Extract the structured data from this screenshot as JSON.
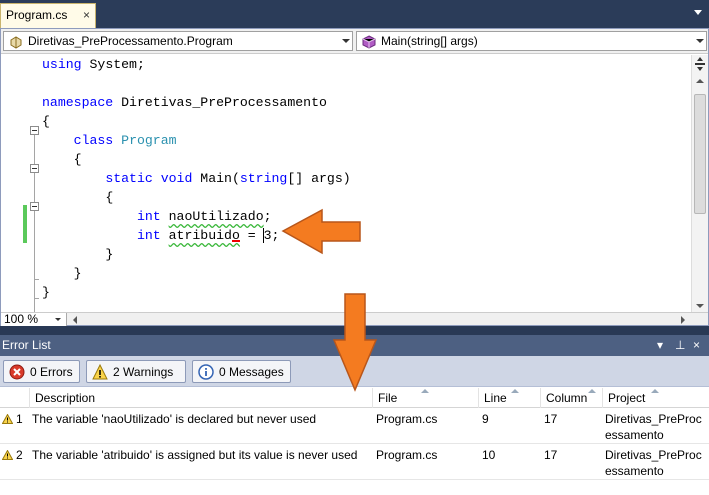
{
  "tab": {
    "title": "Program.cs",
    "close": "×"
  },
  "nav": {
    "type_combo": "Diretivas_PreProcessamento.Program",
    "member_combo": "Main(string[] args)"
  },
  "code": {
    "l1": {
      "kw": "using",
      "rest": " System;"
    },
    "l3": {
      "kw": "namespace",
      "rest": " Diretivas_PreProcessamento"
    },
    "l4": "{",
    "l5": {
      "kw": "class",
      "type": "Program"
    },
    "l6": "{",
    "l7": {
      "kw1": "static",
      "kw2": "void",
      "rest": " Main(",
      "kw3": "string",
      "rest2": "[] args)"
    },
    "l8": "{",
    "l9": {
      "kw": "int",
      "id": "naoUtilizado",
      "rest": ";"
    },
    "l10": {
      "kw": "int",
      "id": "atribuido",
      "rest": " = 3;"
    },
    "l11": "}",
    "l12": "}",
    "l13": "}"
  },
  "zoom": {
    "value": "100 %"
  },
  "error_list": {
    "title": "Error List",
    "controls": {
      "dropdown": "▾",
      "pin": "⊥",
      "close": "×"
    },
    "filters": {
      "errors": "0 Errors",
      "warnings": "2 Warnings",
      "messages": "0 Messages"
    },
    "columns": {
      "description": "Description",
      "file": "File",
      "line": "Line",
      "column": "Column",
      "project": "Project"
    },
    "rows": [
      {
        "num": "1",
        "description": "The variable 'naoUtilizado' is declared but never used",
        "file": "Program.cs",
        "line": "9",
        "column": "17",
        "project": "Diretivas_PreProcessamento"
      },
      {
        "num": "2",
        "description": "The variable 'atribuido' is assigned but its value is never used",
        "file": "Program.cs",
        "line": "10",
        "column": "17",
        "project": "Diretivas_PreProcessamento"
      }
    ]
  },
  "colors": {
    "keyword": "#0000ff",
    "type": "#2b91af",
    "arrow": "#f47b20",
    "title_bar": "#4d6082"
  }
}
